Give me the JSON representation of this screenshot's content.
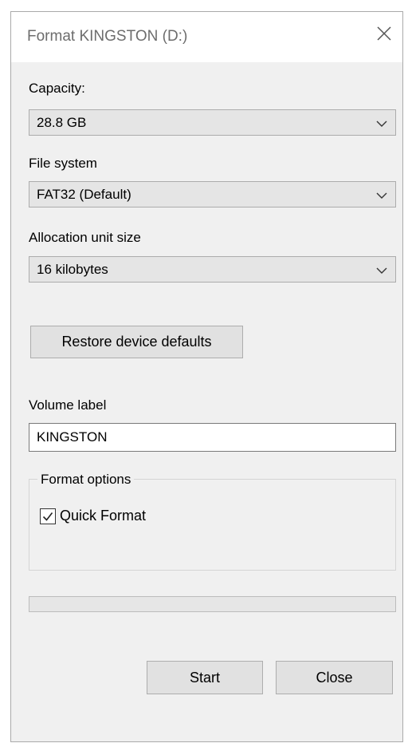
{
  "window": {
    "title": "Format KINGSTON (D:)"
  },
  "capacity": {
    "label": "Capacity:",
    "value": "28.8 GB"
  },
  "file_system": {
    "label": "File system",
    "value": "FAT32 (Default)"
  },
  "allocation": {
    "label": "Allocation unit size",
    "value": "16 kilobytes"
  },
  "restore_button": {
    "label": "Restore device defaults"
  },
  "volume": {
    "label": "Volume label",
    "value": "KINGSTON"
  },
  "format_options": {
    "legend": "Format options",
    "quick_format": {
      "label": "Quick Format",
      "checked": true
    }
  },
  "progress": {
    "value": 0
  },
  "buttons": {
    "start": "Start",
    "close": "Close"
  },
  "icons": {
    "close": "close-icon",
    "dropdown": "chevron-down-icon",
    "check": "checkmark-icon"
  }
}
